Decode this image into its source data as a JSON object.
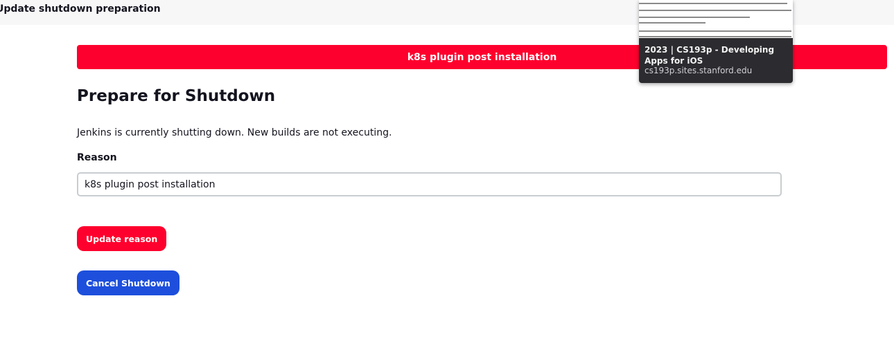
{
  "page": {
    "header_title": "Update shutdown preparation",
    "banner_text": "k8s plugin post installation",
    "title": "Prepare for Shutdown",
    "description": "Jenkins is currently shutting down. New builds are not executing."
  },
  "form": {
    "reason_label": "Reason",
    "reason_value": "k8s plugin post installation"
  },
  "actions": {
    "update_label": "Update reason",
    "cancel_label": "Cancel Shutdown"
  },
  "link_preview": {
    "title": "2023 | CS193p - Developing Apps for iOS",
    "url": "cs193p.sites.stanford.edu"
  },
  "colors": {
    "danger": "#fe002d",
    "primary": "#1d4fdc",
    "text": "#14141f"
  }
}
